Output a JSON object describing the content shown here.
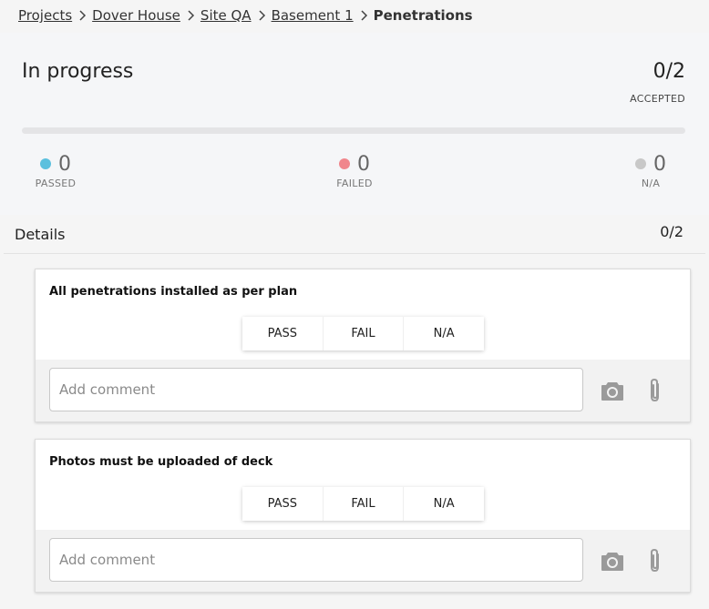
{
  "breadcrumb": {
    "items": [
      "Projects",
      "Dover House",
      "Site QA",
      "Basement 1"
    ],
    "current": "Penetrations"
  },
  "summary": {
    "status": "In progress",
    "accepted_count": "0/2",
    "accepted_label": "ACCEPTED",
    "progress_fraction": 0,
    "stats": {
      "passed": {
        "value": "0",
        "label": "PASSED",
        "color": "#5bc0de"
      },
      "failed": {
        "value": "0",
        "label": "FAILED",
        "color": "#f0868c"
      },
      "na": {
        "value": "0",
        "label": "N/A",
        "color": "#c8c8c8"
      }
    }
  },
  "details": {
    "title": "Details",
    "count": "0/2"
  },
  "items": [
    {
      "title": "All penetrations installed as per plan",
      "pass_label": "PASS",
      "fail_label": "FAIL",
      "na_label": "N/A",
      "comment_placeholder": "Add comment",
      "comment_value": ""
    },
    {
      "title": "Photos must be uploaded of deck",
      "pass_label": "PASS",
      "fail_label": "FAIL",
      "na_label": "N/A",
      "comment_placeholder": "Add comment",
      "comment_value": ""
    }
  ],
  "icons": {
    "breadcrumb_separator": "chevron-right-icon",
    "photo": "camera-icon",
    "attachment": "paperclip-icon"
  }
}
